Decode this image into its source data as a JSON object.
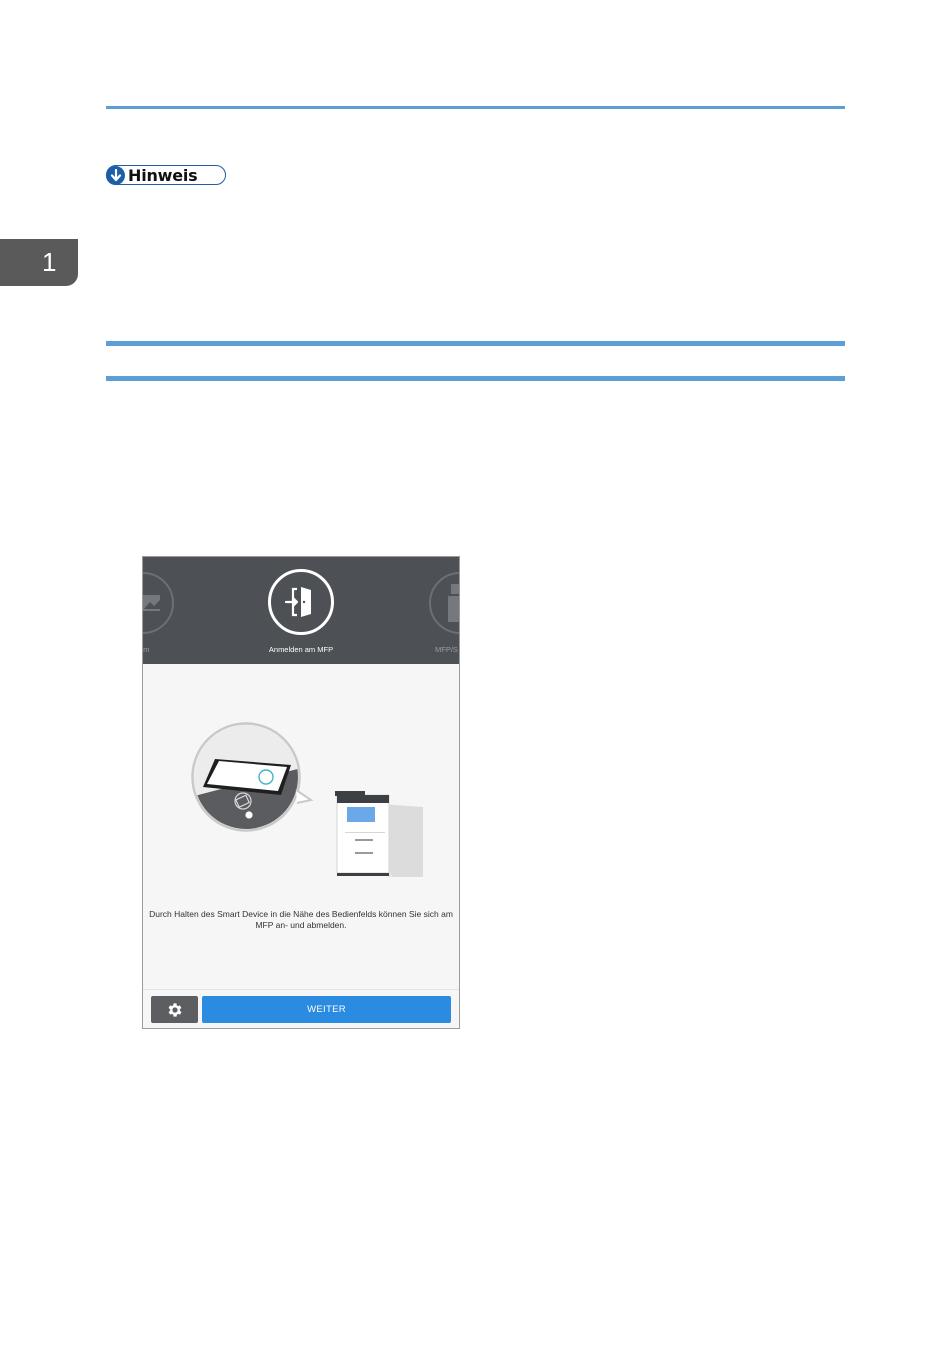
{
  "chapter": {
    "number": "1"
  },
  "note": {
    "label": "Hinweis"
  },
  "app_screen": {
    "carousel": {
      "left_label": "um",
      "center_label": "Anmelden am MFP",
      "right_label": "MFP/S"
    },
    "message": "Durch Halten des Smart Device in die Nähe des Bedienfelds können Sie sich am MFP an- und abmelden.",
    "next_button_label": "WEITER",
    "accent_color": "#2a8be0",
    "header_color": "#4d5055"
  }
}
